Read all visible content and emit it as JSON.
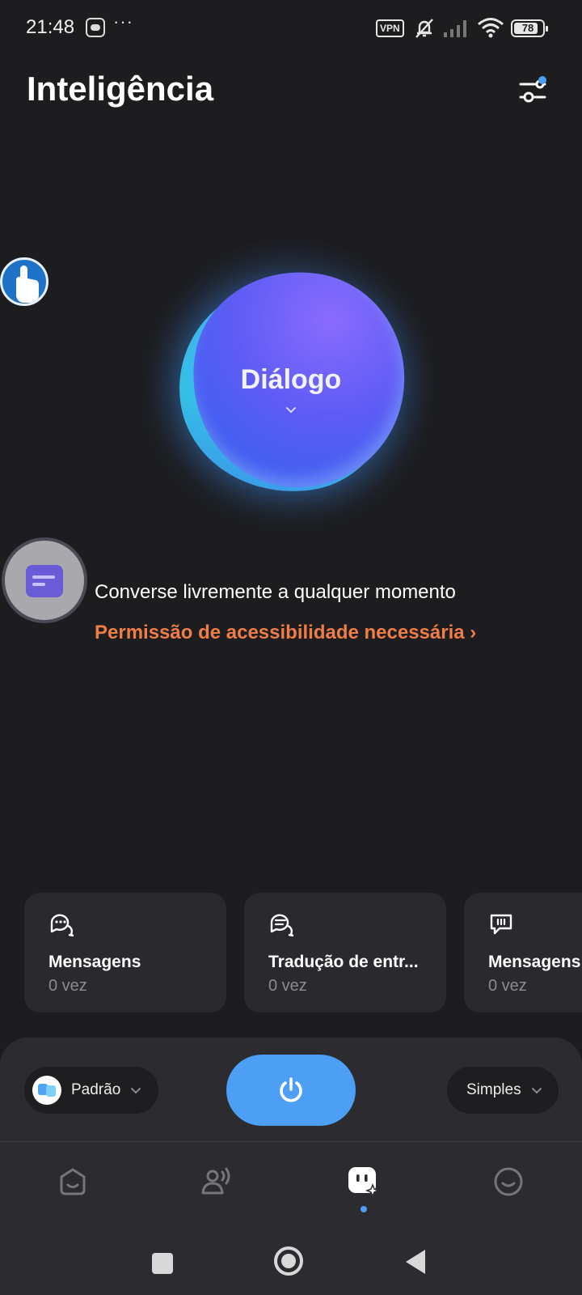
{
  "status_bar": {
    "time": "21:48",
    "more_indicator": "···",
    "vpn": "VPN",
    "battery": "78",
    "battery_level": 0.78,
    "icons": [
      "discord-icon",
      "mute-icon",
      "signal-icon",
      "wifi-icon",
      "battery-icon"
    ]
  },
  "header": {
    "title": "Inteligência",
    "settings_icon": "sliders-icon",
    "settings_badge_color": "#4d9ef5"
  },
  "orb": {
    "label": "Diálogo"
  },
  "feature": {
    "description": "Converse livremente a qualquer momento",
    "permission_link": "Permissão de acessibilidade necessária ›",
    "link_color": "#ef7d46"
  },
  "cards": [
    {
      "title": "Mensagens",
      "count": "0 vez",
      "icon": "chat-bubbles-icon"
    },
    {
      "title": "Tradução de entr...",
      "count": "0 vez",
      "icon": "translate-chat-icon"
    },
    {
      "title": "Mensagens",
      "count": "0 vez",
      "icon": "message-pause-icon"
    }
  ],
  "controls": {
    "left_mode": "Padrão",
    "right_mode": "Simples",
    "power_color": "#4d9ef5"
  },
  "tabs": [
    {
      "icon": "home-icon",
      "active": false
    },
    {
      "icon": "voice-icon",
      "active": false
    },
    {
      "icon": "ai-assistant-icon",
      "active": true
    },
    {
      "icon": "profile-icon",
      "active": false
    }
  ],
  "colors": {
    "background": "#1d1d20",
    "accent": "#4d9ef5",
    "card": "#2a2a2e"
  }
}
